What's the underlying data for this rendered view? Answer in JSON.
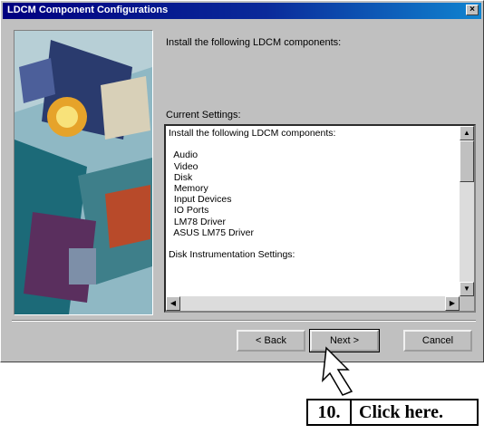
{
  "window": {
    "title": "LDCM Component Configurations",
    "close_glyph": "×"
  },
  "dialog": {
    "intro": "Install the following LDCM components:",
    "current_settings_label": "Current Settings:",
    "settings_text": "Install the following LDCM components:\n\n  Audio\n  Video\n  Disk\n  Memory\n  Input Devices\n  IO Ports\n  LM78 Driver\n  ASUS LM75 Driver\n\nDisk Instrumentation Settings:"
  },
  "buttons": {
    "back": "< Back",
    "next": "Next >",
    "cancel": "Cancel"
  },
  "scroll_icons": {
    "up": "▲",
    "down": "▼",
    "left": "◀",
    "right": "▶"
  },
  "callout": {
    "number": "10.",
    "text": "Click here."
  },
  "colors": {
    "titlebar_start": "#000080",
    "titlebar_end": "#1084d0",
    "face": "#c0c0c0"
  }
}
